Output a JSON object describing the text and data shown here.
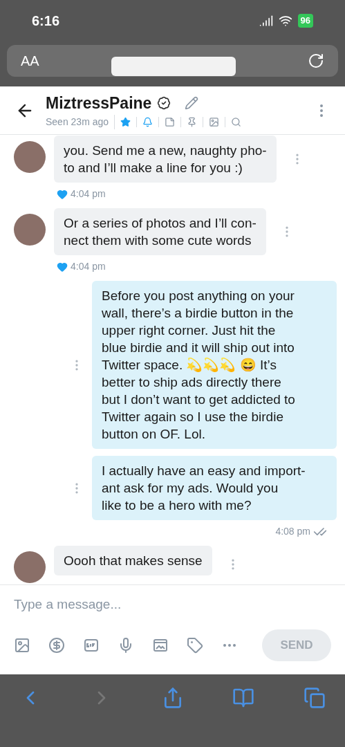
{
  "status_bar": {
    "time": "6:16",
    "battery": "96"
  },
  "browser": {
    "text_size_button": "AA"
  },
  "chat_header": {
    "name": "MiztressPaine",
    "verified": true,
    "seen": "Seen 23m ago",
    "tools": [
      {
        "kind": "star",
        "active": true
      },
      {
        "kind": "bell",
        "active": true
      },
      {
        "kind": "note",
        "active": false
      },
      {
        "kind": "pin",
        "active": false
      },
      {
        "kind": "image",
        "active": false
      },
      {
        "kind": "search",
        "active": false
      }
    ]
  },
  "messages": [
    {
      "kind": "incoming",
      "lines": [
        "you. Send me a new, naughty pho-",
        "to and I’ll make a line for you :)"
      ],
      "liked": true,
      "time": "4:04 pm",
      "read": false
    },
    {
      "kind": "incoming",
      "lines": [
        "Or a series of photos and I’ll con-",
        "nect them with some cute words"
      ],
      "liked": true,
      "time": "4:04 pm",
      "read": false
    },
    {
      "kind": "outgoing",
      "lines": [
        "Before you post anything on your",
        "wall, there’s a birdie button in the",
        "upper right corner. Just hit the",
        "blue birdie and it will ship out into",
        "Twitter space. 💫💫💫 😄 It’s",
        "better to ship ads directly there",
        "but I don’t want to get addicted to",
        "Twitter again so I use the birdie",
        "button on OF. Lol."
      ],
      "liked": false,
      "read": false
    },
    {
      "kind": "outgoing",
      "lines": [
        "I actually have an easy and import-",
        "ant ask for my ads. Would you",
        "like to be a hero with me?"
      ],
      "liked": false,
      "time": "4:08 pm",
      "read": true
    },
    {
      "kind": "incoming",
      "lines": [
        "Oooh that makes sense"
      ],
      "liked": false,
      "read": false
    }
  ],
  "composer": {
    "placeholder": "Type a message...",
    "send_button": "SEND",
    "send_disabled": true
  }
}
